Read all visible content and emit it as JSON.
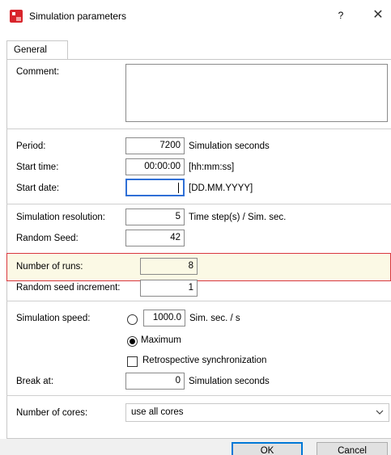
{
  "window": {
    "title": "Simulation parameters",
    "help_label": "?",
    "close_label": "✕"
  },
  "tabs": [
    {
      "label": "General"
    }
  ],
  "form": {
    "comment_label": "Comment:",
    "comment_value": "",
    "period_label": "Period:",
    "period_value": "7200",
    "period_unit": "Simulation seconds",
    "start_time_label": "Start time:",
    "start_time_value": "00:00:00",
    "start_time_unit": "[hh:mm:ss]",
    "start_date_label": "Start date:",
    "start_date_value": "",
    "start_date_unit": "[DD.MM.YYYY]",
    "resolution_label": "Simulation resolution:",
    "resolution_value": "5",
    "resolution_unit": "Time step(s) / Sim. sec.",
    "seed_label": "Random Seed:",
    "seed_value": "42",
    "runs_label": "Number of runs:",
    "runs_value": "8",
    "seed_increment_label": "Random seed increment:",
    "seed_increment_value": "1",
    "speed_label": "Simulation speed:",
    "speed_value": "1000.0",
    "speed_unit": "Sim. sec. / s",
    "speed_max_label": "Maximum",
    "speed_selected": "Maximum",
    "retro_sync_label": "Retrospective synchronization",
    "retro_sync_checked": false,
    "break_label": "Break at:",
    "break_value": "0",
    "break_unit": "Simulation seconds",
    "cores_label": "Number of cores:",
    "cores_value": "use all cores"
  },
  "buttons": {
    "ok": "OK",
    "cancel": "Cancel"
  },
  "colors": {
    "highlight_border": "#d9363e",
    "highlight_fill": "#fbf9e5",
    "focus_border": "#2f6fd6",
    "default_button_border": "#0078d7"
  },
  "icons": {
    "app": "simulation-app-icon",
    "cores_dropdown": "chevron-down-icon"
  }
}
